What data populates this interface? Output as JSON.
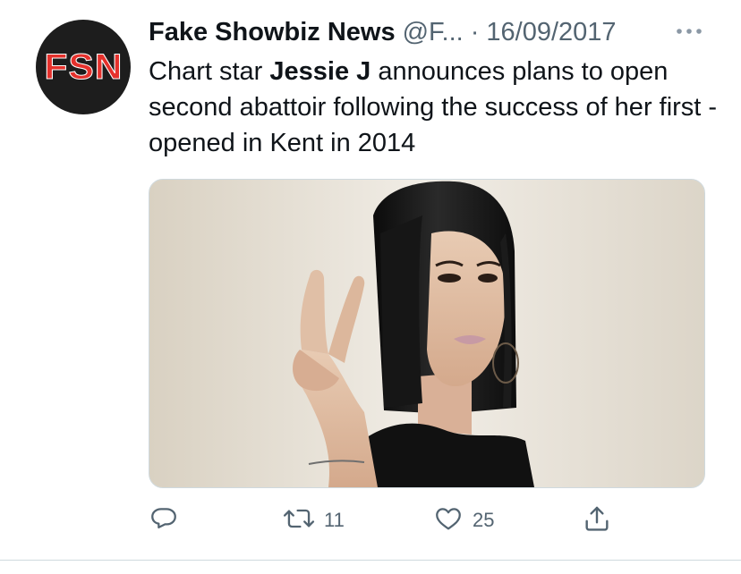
{
  "tweet": {
    "avatar_text": "FSN",
    "display_name": "Fake Showbiz News",
    "handle": "@F...",
    "separator": "·",
    "date": "16/09/2017",
    "text_before": "Chart star ",
    "text_bold": "Jessie J",
    "text_after": " announces plans to open second abattoir following the success of her first - opened in Kent in 2014"
  },
  "actions": {
    "retweet_count": "11",
    "like_count": "25"
  },
  "icons": {
    "more": "more-icon",
    "reply": "reply-icon",
    "retweet": "retweet-icon",
    "like": "like-icon",
    "share": "share-icon"
  },
  "colors": {
    "text": "#0f1419",
    "secondary": "#536471",
    "avatar_bg": "#1d1d1d",
    "avatar_text": "#e5312c",
    "border": "#cfd9de"
  }
}
